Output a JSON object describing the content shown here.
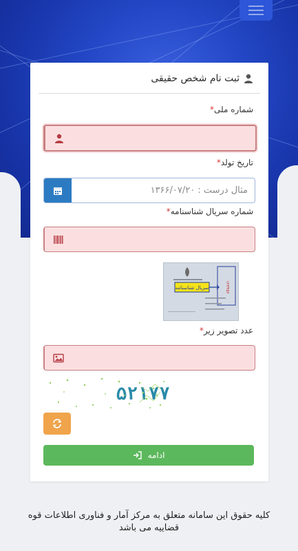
{
  "form": {
    "title": "ثبت نام شخص حقیقی",
    "national_code": {
      "label": "شماره ملی",
      "required": "*",
      "value": ""
    },
    "birth_date": {
      "label": "تاریخ تولد",
      "required": "*",
      "placeholder": "مثال درست : ۱۳۶۶/۰۷/۲۰",
      "value": ""
    },
    "serial": {
      "label": "شماره سریال شناسنامه",
      "required": "*",
      "value": "",
      "hint_image_text": "سریال شناسنامه"
    },
    "captcha": {
      "label": "عدد تصویر زیر",
      "required": "*",
      "value": "",
      "image_text": "۵۲۱۷۷"
    },
    "submit_label": "ادامه"
  },
  "footer": {
    "text": "کلیه حقوق این سامانه متعلق به مرکز آمار و فناوری اطلاعات قوه قضاییه می باشد"
  },
  "colors": {
    "primary": "#2347c6",
    "error_bg": "#fbdfe0",
    "submit": "#5cb85c",
    "refresh": "#f0a44b",
    "date_addon": "#2c7bc2"
  },
  "icons": [
    "user-icon",
    "calendar-icon",
    "barcode-icon",
    "image-icon",
    "refresh-icon",
    "sign-in-icon",
    "menu-icon"
  ]
}
